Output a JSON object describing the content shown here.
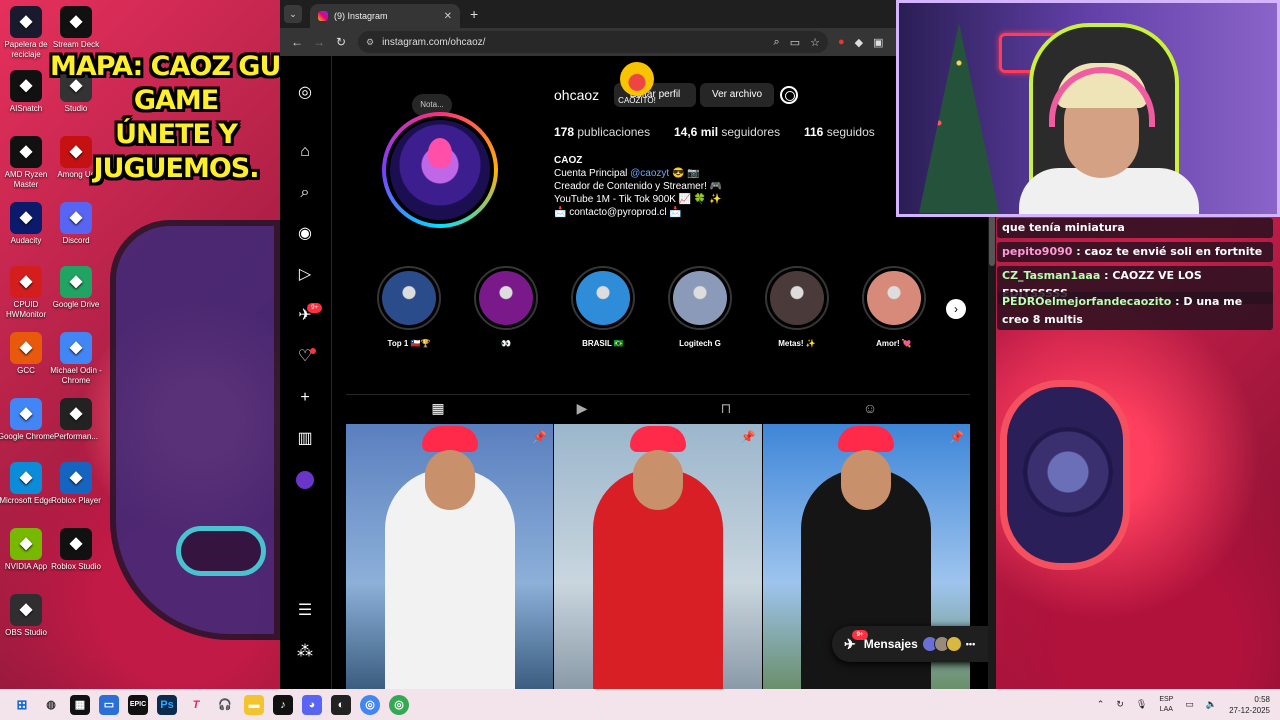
{
  "overlay": {
    "title_line1": "MAPA: CAOZ GUN GAME",
    "title_line2": "ÚNETE Y JUGUEMOS."
  },
  "desktop_icons": [
    {
      "label": "Papelera de reciclaje",
      "icon": "recycle-bin-icon",
      "color": "#1a1a2e"
    },
    {
      "label": "Stream Deck",
      "icon": "stream-deck-icon",
      "color": "#111"
    },
    {
      "label": "AISnatch",
      "icon": "aisnatch-icon",
      "color": "#111"
    },
    {
      "label": "Studio",
      "icon": "studio-icon",
      "color": "#333"
    },
    {
      "label": "AMD Ryzen Master",
      "icon": "amd-ryzen-icon",
      "color": "#111"
    },
    {
      "label": "Among Us",
      "icon": "among-us-icon",
      "color": "#c51111"
    },
    {
      "label": "Audacity",
      "icon": "audacity-icon",
      "color": "#0b1a6b"
    },
    {
      "label": "Discord",
      "icon": "discord-icon",
      "color": "#5865f2"
    },
    {
      "label": "CPUID HWMonitor",
      "icon": "hwmonitor-icon",
      "color": "#d41e1e"
    },
    {
      "label": "Google Drive",
      "icon": "google-drive-icon",
      "color": "#1fa463"
    },
    {
      "label": "GCC",
      "icon": "gcc-icon",
      "color": "#e8590c"
    },
    {
      "label": "Michael Odin - Chrome",
      "icon": "chrome-icon",
      "color": "#4285f4"
    },
    {
      "label": "Google Chrome",
      "icon": "chrome-icon",
      "color": "#4285f4"
    },
    {
      "label": "Performan...",
      "icon": "performance-icon",
      "color": "#222"
    },
    {
      "label": "Microsoft Edge",
      "icon": "edge-icon",
      "color": "#0c8cd8"
    },
    {
      "label": "Roblox Player",
      "icon": "roblox-icon",
      "color": "#1565c0"
    },
    {
      "label": "NVIDIA App",
      "icon": "nvidia-icon",
      "color": "#76b900"
    },
    {
      "label": "Roblox Studio",
      "icon": "roblox-studio-icon",
      "color": "#111"
    },
    {
      "label": "OBS Studio",
      "icon": "obs-icon",
      "color": "#302e31"
    }
  ],
  "browser": {
    "tab_title": "(9) Instagram",
    "url": "instagram.com/ohcaoz/"
  },
  "instagram": {
    "note": "Nota...",
    "username": "ohcaoz",
    "edit_profile": "Editar perfil",
    "archive": "Ver archivo",
    "overlay_badge": "CAOZITO!",
    "stats": {
      "posts_count": "178",
      "posts_label": "publicaciones",
      "followers_count": "14,6 mil",
      "followers_label": "seguidores",
      "following_count": "116",
      "following_label": "seguidos"
    },
    "bio": {
      "name": "CAOZ",
      "line1_prefix": "Cuenta Principal",
      "line1_link": "@caozyt",
      "line1_suffix": "😎 📷",
      "line2": "Creador de Contenido y Streamer! 🎮",
      "line3": "YouTube 1M - Tik Tok 900K 📈 🍀 ✨",
      "line4": "📩 contacto@pyroprod.cl 📩"
    },
    "highlights": [
      {
        "label": "Top 1 🇨🇱🏆",
        "color": "#2a4c8a"
      },
      {
        "label": "👀",
        "color": "#7a1a8a"
      },
      {
        "label": "BRASIL 🇧🇷",
        "color": "#2e8cd8"
      },
      {
        "label": "Logitech G",
        "color": "#8a9ab8"
      },
      {
        "label": "Metas! ✨",
        "color": "#4a3a3a"
      },
      {
        "label": "Amor! 💘",
        "color": "#d88a7a"
      }
    ],
    "messages": {
      "label": "Mensajes",
      "badge": "9+"
    },
    "nav_badge": "9+"
  },
  "chat": [
    {
      "user": "",
      "text": "que tenía miniatura"
    },
    {
      "user": "pepito9090",
      "text": ": caoz te envié soli en fortnite"
    },
    {
      "user": "CZ_Tasman1aaa",
      "text": ": CAOZZ VE LOS EDITSSSSS"
    },
    {
      "user": "PEDROelmejorfandecaozito",
      "text": ": D una me creo 8 multis"
    }
  ],
  "taskbar": {
    "lang_line1": "ESP",
    "lang_line2": "LAA",
    "time": "0:58",
    "date": "27-12-2025"
  }
}
